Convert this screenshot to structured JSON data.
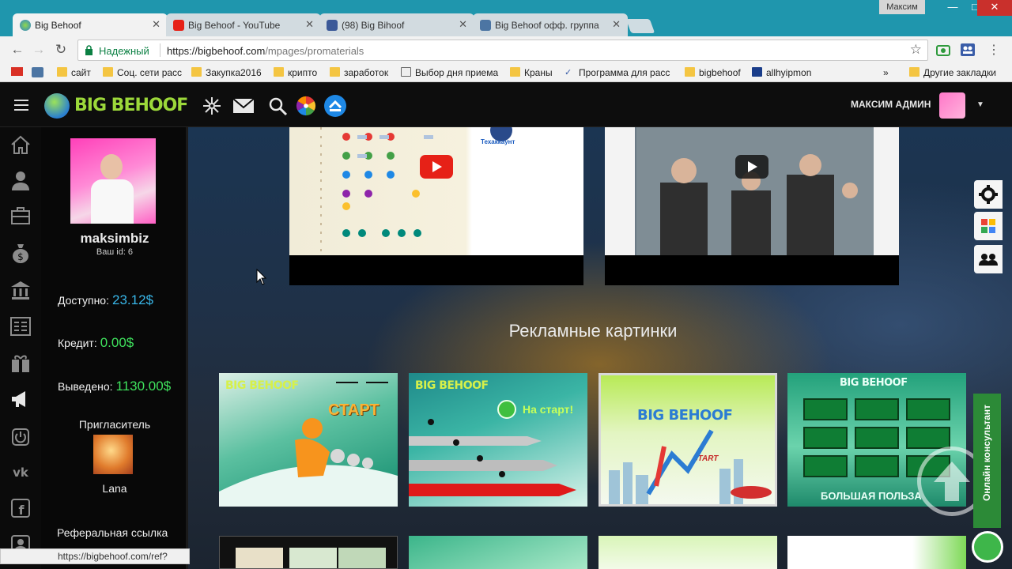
{
  "browser": {
    "profile_name": "Максим",
    "tabs": [
      {
        "title": "Big Behoof",
        "active": true,
        "favicon": "bigbehoof-icon"
      },
      {
        "title": "Big Behoof - YouTube",
        "active": false,
        "favicon": "youtube-icon"
      },
      {
        "title": "(98) Big Bihoof",
        "active": false,
        "favicon": "facebook-icon"
      },
      {
        "title": "Big Behoof офф. группа",
        "active": false,
        "favicon": "vk-icon"
      }
    ],
    "secure_label": "Надежный",
    "url_base": "https://bigbehoof.com",
    "url_path": "/mpages/promaterials",
    "bookmarks": [
      "сайт",
      "Соц. сети расс",
      "Закупка2016",
      "крипто",
      "заработок",
      "Выбор дня приема",
      "Краны",
      "Программа для расс",
      "bigbehoof",
      "allhyipmon"
    ],
    "other_bookmarks": "Другие закладки",
    "status_url": "https://bigbehoof.com/ref?"
  },
  "site": {
    "logo_text": "BIG BEHOOF",
    "header_icons": [
      "crosshair-icon",
      "mail-icon",
      "search-icon",
      "fortune-wheel-icon",
      "badge-icon"
    ],
    "user_name": "МАКСИМ АДМИН"
  },
  "rail_icons": [
    "home-icon",
    "user-icon",
    "briefcase-icon",
    "money-bag-icon",
    "bank-icon",
    "list-icon",
    "gift-icon",
    "megaphone-icon",
    "power-icon",
    "vk-icon",
    "facebook-icon",
    "people-icon"
  ],
  "profile": {
    "username": "maksimbiz",
    "user_id_label": "Ваш id: 6",
    "available_label": "Доступно:",
    "available_value": "23.12$",
    "credit_label": "Кредит:",
    "credit_value": "0.00$",
    "withdrawn_label": "Выведено:",
    "withdrawn_value": "1130.00$",
    "inviter_label": "Пригласитель",
    "inviter_name": "Lana",
    "ref_link_label": "Реферальная ссылка"
  },
  "content": {
    "section_title": "Рекламные картинки",
    "video1_text": "Техаккаунт",
    "banners": [
      {
        "logo": "BIG BEHOOF",
        "text": "СТАРТ"
      },
      {
        "logo": "BIG BEHOOF",
        "text": "На старт!"
      },
      {
        "logo": "BIG BEHOOF",
        "text": "START"
      },
      {
        "logo": "BIG BEHOOF",
        "text": "БОЛЬШАЯ ПОЛЬЗА"
      }
    ]
  },
  "consultant_label": "Онлайн консультант",
  "colors": {
    "titlebar": "#1f96ad",
    "available": "#38b6e8",
    "green_value": "#3fe25d",
    "consultant": "#2c8a37"
  }
}
